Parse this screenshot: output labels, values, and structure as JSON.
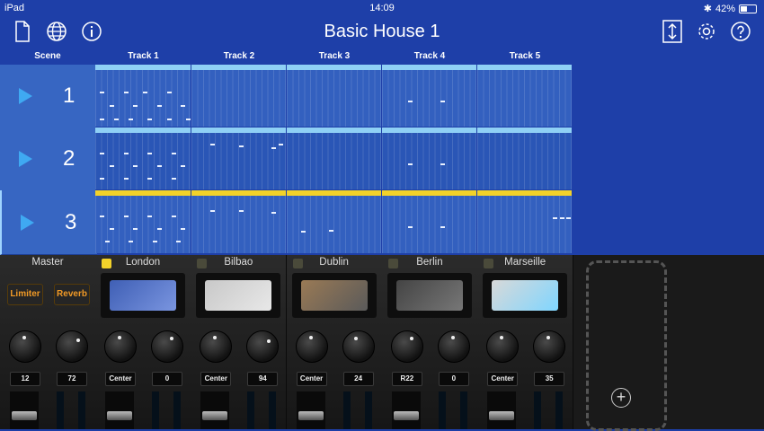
{
  "status": {
    "device": "iPad",
    "time": "14:09",
    "battery": "42%",
    "bluetooth_icon": "bluetooth-icon"
  },
  "toolbar": {
    "title": "Basic House 1",
    "new_icon": "document-icon",
    "web_icon": "globe-icon",
    "info_icon": "info-icon",
    "resize_icon": "vertical-resize-icon",
    "settings_icon": "gear-icon",
    "help_icon": "question-icon"
  },
  "grid": {
    "scene_header": "Scene",
    "tracks": [
      "Track 1",
      "Track 2",
      "Track 3",
      "Track 4",
      "Track 5"
    ],
    "scenes": [
      "1",
      "2",
      "3"
    ],
    "colors": {
      "playing": "#f2d22a",
      "idle": "#8fd0f5",
      "cell": "#3360bf",
      "cell_alt": "#2a56b6"
    }
  },
  "mixer": {
    "master": {
      "name": "Master",
      "fx": [
        "Limiter",
        "Reverb"
      ],
      "values": [
        "12",
        "72"
      ]
    },
    "channels": [
      {
        "name": "London",
        "active": true,
        "values": [
          "Center",
          "0"
        ]
      },
      {
        "name": "Bilbao",
        "active": false,
        "values": [
          "Center",
          "94"
        ]
      },
      {
        "name": "Dublin",
        "active": false,
        "values": [
          "Center",
          "24"
        ]
      },
      {
        "name": "Berlin",
        "active": false,
        "values": [
          "R22",
          "0"
        ]
      },
      {
        "name": "Marseille",
        "active": false,
        "values": [
          "Center",
          "35"
        ]
      }
    ],
    "add_label": "+"
  }
}
